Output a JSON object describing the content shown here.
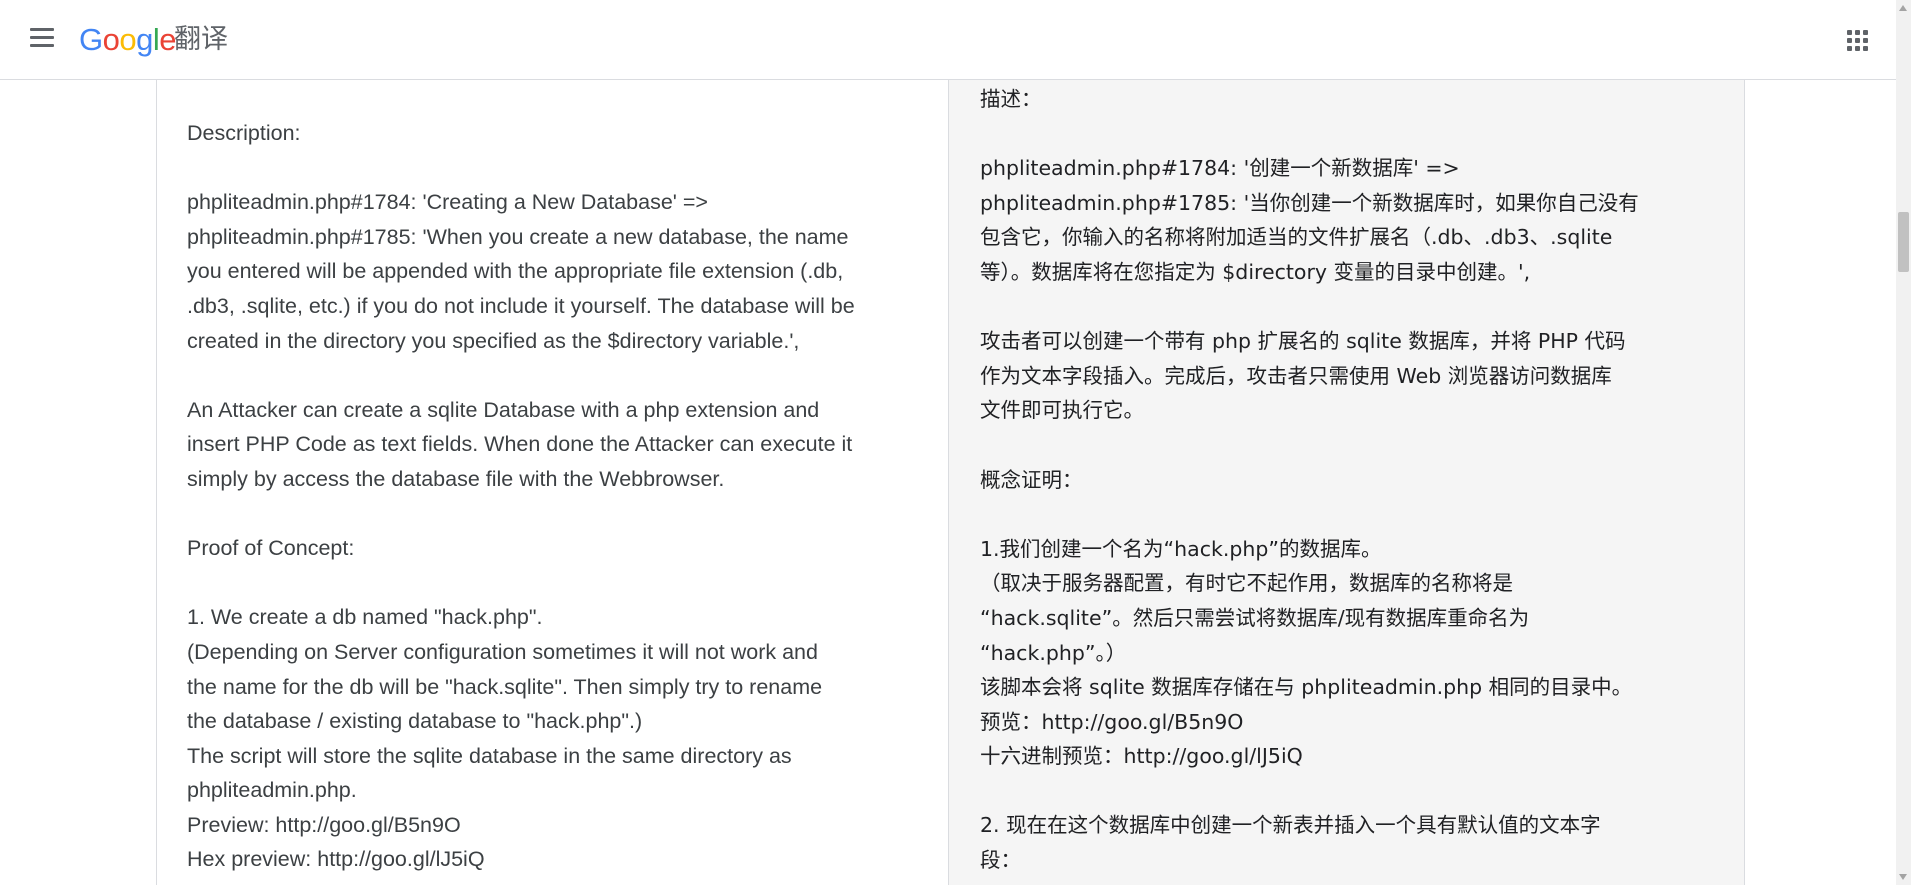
{
  "header": {
    "menu_icon": "menu-icon",
    "logo_letters": [
      "G",
      "o",
      "o",
      "g",
      "l",
      "e"
    ],
    "product_name": "翻译",
    "apps_icon": "apps-grid-icon",
    "colors": {
      "blue": "#4285f4",
      "red": "#ea4335",
      "yellow": "#fbbc05",
      "green": "#34a853"
    }
  },
  "source_panel": {
    "text": "Description:\n\nphpliteadmin.php#1784: 'Creating a New Database' =>\nphpliteadmin.php#1785: 'When you create a new database, the name\nyou entered will be appended with the appropriate file extension (.db,\n.db3, .sqlite, etc.) if you do not include it yourself. The database will be\ncreated in the directory you specified as the $directory variable.',\n\nAn Attacker can create a sqlite Database with a php extension and\ninsert PHP Code as text fields. When done the Attacker can execute it\nsimply by access the database file with the Webbrowser.\n\nProof of Concept:\n\n1. We create a db named \"hack.php\".\n(Depending on Server configuration sometimes it will not work and\nthe name for the db will be \"hack.sqlite\". Then simply try to rename\nthe database / existing database to \"hack.php\".)\nThe script will store the sqlite database in the same directory as\nphpliteadmin.php.\nPreview: http://goo.gl/B5n9O\nHex preview: http://goo.gl/lJ5iQ"
  },
  "translation_panel": {
    "text": "描述：\n\nphpliteadmin.php#1784: '创建一个新数据库' =>\nphpliteadmin.php#1785: '当你创建一个新数据库时，如果你自己没有\n包含它，你输入的名称将附加适当的文件扩展名（.db、.db3、.sqlite\n等）。数据库将在您指定为 $directory 变量的目录中创建。',\n\n攻击者可以创建一个带有 php 扩展名的 sqlite 数据库，并将 PHP 代码\n作为文本字段插入。完成后，攻击者只需使用 Web 浏览器访问数据库\n文件即可执行它。\n\n概念证明：\n\n1.我们创建一个名为“hack.php”的数据库。\n（取决于服务器配置，有时它不起作用，数据库的名称将是\n“hack.sqlite”。然后只需尝试将数据库/现有数据库重命名为\n“hack.php”。）\n该脚本会将 sqlite 数据库存储在与 phpliteadmin.php 相同的目录中。\n预览：http://goo.gl/B5n9O\n十六进制预览：http://goo.gl/lJ5iQ\n\n2. 现在在这个数据库中创建一个新表并插入一个具有默认值的文本字\n段："
  }
}
